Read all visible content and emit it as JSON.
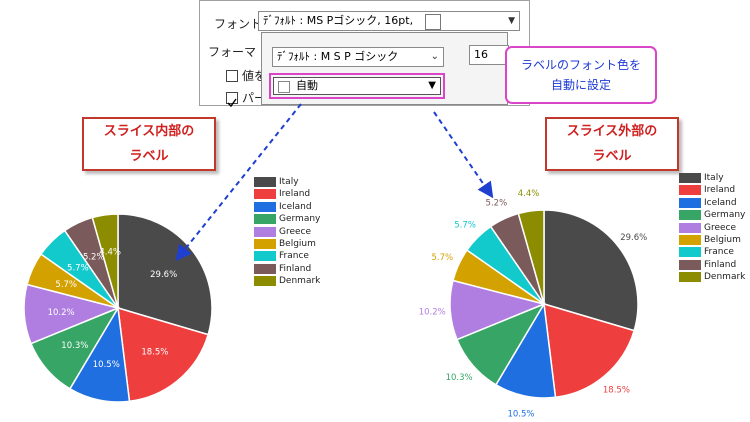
{
  "dialog": {
    "font_label": "フォント",
    "font_value": "ﾃﾞﾌｫﾙﾄ : MS Pゴシック, 16pt,",
    "format_label": "フォーマ",
    "checkbox1_label": "値を",
    "checkbox2_label": "パー",
    "font_name_value": "ﾃﾞﾌｫﾙﾄ : M S P ゴシック",
    "font_size_value": "16",
    "color_value": "自動"
  },
  "callout": {
    "line1": "ラベルのフォント色を",
    "line2": "自動に設定"
  },
  "labels": {
    "inside_line1": "スライス内部の",
    "inside_line2": "ラベル",
    "outside_line1": "スライス外部の",
    "outside_line2": "ラベル"
  },
  "colors": {
    "highlight": "#d946c8",
    "label_border": "#c0392b",
    "arrow": "#1f3fd1"
  },
  "chart_data": [
    {
      "type": "pie",
      "label_position": "inside",
      "categories": [
        "Italy",
        "Ireland",
        "Iceland",
        "Germany",
        "Greece",
        "Belgium",
        "France",
        "Finland",
        "Denmark"
      ],
      "values": [
        29.6,
        18.5,
        10.5,
        10.3,
        10.2,
        5.7,
        5.7,
        5.2,
        4.4
      ],
      "labels": [
        "29.6%",
        "18.5%",
        "10.5%",
        "10.3%",
        "10.2%",
        "5.7%",
        "5.7%",
        "5.2%",
        "4.4%"
      ],
      "colors": [
        "#4a4a4a",
        "#ee3e3e",
        "#1f6fe0",
        "#37a565",
        "#b07ee0",
        "#d4a200",
        "#12c9cc",
        "#7a5a5a",
        "#8c8c00"
      ],
      "legend_position": "right"
    },
    {
      "type": "pie",
      "label_position": "outside",
      "categories": [
        "Italy",
        "Ireland",
        "Iceland",
        "Germany",
        "Greece",
        "Belgium",
        "France",
        "Finland",
        "Denmark"
      ],
      "values": [
        29.6,
        18.5,
        10.5,
        10.3,
        10.2,
        5.7,
        5.7,
        5.2,
        4.4
      ],
      "labels": [
        "29.6%",
        "18.5%",
        "10.5%",
        "10.3%",
        "10.2%",
        "5.7%",
        "5.7%",
        "5.2%",
        "4.4%"
      ],
      "colors": [
        "#4a4a4a",
        "#ee3e3e",
        "#1f6fe0",
        "#37a565",
        "#b07ee0",
        "#d4a200",
        "#12c9cc",
        "#7a5a5a",
        "#8c8c00"
      ],
      "legend_position": "right"
    }
  ]
}
